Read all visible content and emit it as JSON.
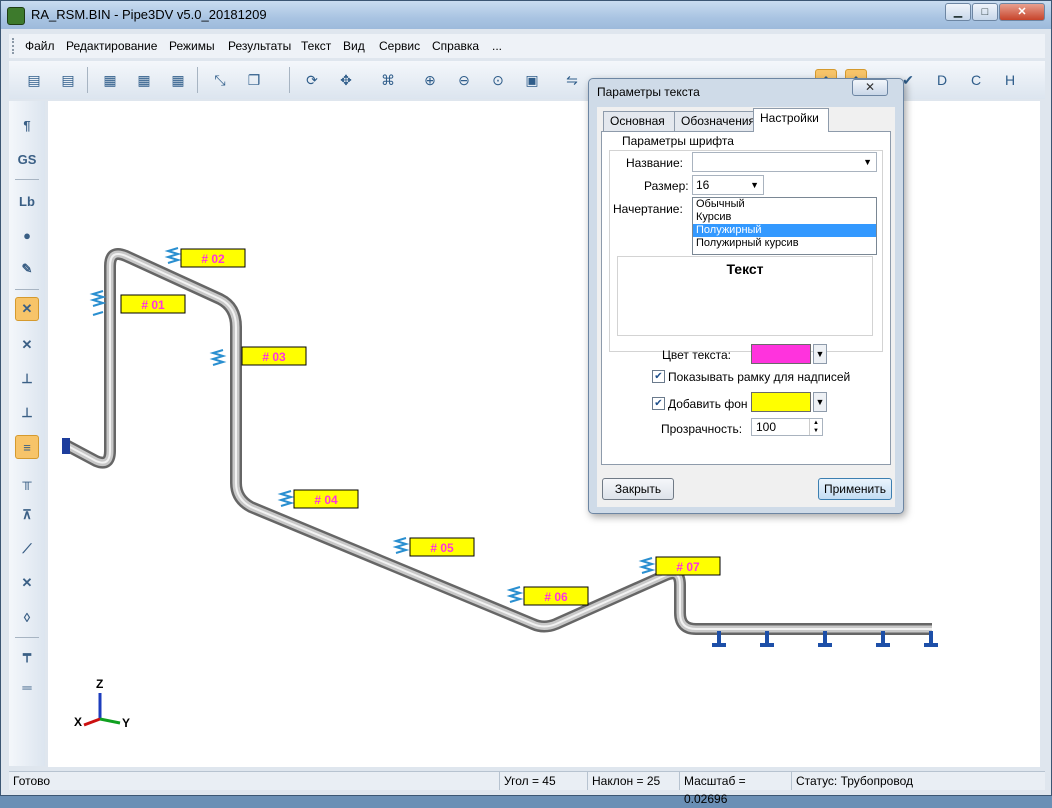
{
  "window": {
    "title": "RA_RSM.BIN - Pipe3DV v5.0_20181209",
    "min": "▁",
    "max": "□",
    "close": "✕"
  },
  "menu": [
    "Файл",
    "Редактирование",
    "Режимы",
    "Результаты",
    "Текст",
    "Вид",
    "Сервис",
    "Справка",
    "..."
  ],
  "tags": [
    "# 01",
    "# 02",
    "# 03",
    "# 04",
    "# 05",
    "# 06",
    "# 07"
  ],
  "axes": {
    "z": "Z",
    "x": "X",
    "y": "Y"
  },
  "left_tools": [
    "¶",
    "GS",
    "Lb"
  ],
  "dialog": {
    "title": "Параметры текста",
    "close": "✕",
    "tabs": [
      "Основная",
      "Обозначения",
      "Настройки"
    ],
    "group_label": "Параметры шрифта",
    "name_label": "Название:",
    "name_value": "",
    "size_label": "Размер:",
    "size_value": "16",
    "style_label": "Начертание:",
    "styles": [
      "Обычный",
      "Курсив",
      "Полужирный",
      "Полужирный курсив"
    ],
    "preview_text": "Текст",
    "color_label": "Цвет текста:",
    "text_color": "#ff33dd",
    "show_frame_label": "Показывать рамку для надписей",
    "add_bg_label": "Добавить фон",
    "bg_color": "#ffff00",
    "transparency_label": "Прозрачность:",
    "transparency_value": "100",
    "close_button": "Закрыть",
    "apply_button": "Применить"
  },
  "status": {
    "ready": "Готово",
    "angle": "Угол = 45",
    "tilt": "Наклон = 25",
    "scale": "Масштаб = 0.02696",
    "status": "Статус: Трубопровод"
  }
}
